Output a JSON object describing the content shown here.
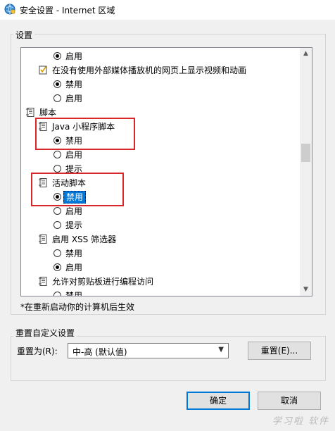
{
  "window": {
    "title": "安全设置 - Internet 区域",
    "icon": "globe-shield-icon"
  },
  "settings_group": {
    "label": "设置",
    "rows": [
      {
        "kind": "radio",
        "label": "启用",
        "checked": true
      },
      {
        "kind": "setting",
        "label": "在没有使用外部媒体播放机的网页上显示视频和动画",
        "icon": "checkbox-setting-icon"
      },
      {
        "kind": "radio",
        "label": "禁用",
        "checked": true
      },
      {
        "kind": "radio",
        "label": "启用",
        "checked": false
      },
      {
        "kind": "category",
        "label": "脚本",
        "icon": "script-icon"
      },
      {
        "kind": "setting",
        "label": "Java 小程序脚本",
        "icon": "script-icon"
      },
      {
        "kind": "radio",
        "label": "禁用",
        "checked": true
      },
      {
        "kind": "radio",
        "label": "启用",
        "checked": false
      },
      {
        "kind": "radio",
        "label": "提示",
        "checked": false
      },
      {
        "kind": "setting",
        "label": "活动脚本",
        "icon": "script-icon"
      },
      {
        "kind": "radio",
        "label": "禁用",
        "checked": true,
        "selected": true
      },
      {
        "kind": "radio",
        "label": "启用",
        "checked": false
      },
      {
        "kind": "radio",
        "label": "提示",
        "checked": false
      },
      {
        "kind": "setting",
        "label": "启用 XSS 筛选器",
        "icon": "script-icon"
      },
      {
        "kind": "radio",
        "label": "禁用",
        "checked": false
      },
      {
        "kind": "radio",
        "label": "启用",
        "checked": true
      },
      {
        "kind": "setting",
        "label": "允许对剪贴板进行编程访问",
        "icon": "script-icon"
      },
      {
        "kind": "radio",
        "label": "禁用",
        "checked": false
      }
    ],
    "note": "*在重新启动你的计算机后生效"
  },
  "reset_group": {
    "label": "重置自定义设置",
    "reset_to_label": "重置为(R):",
    "reset_level": "中-高 (默认值)",
    "reset_button": "重置(E)..."
  },
  "footer": {
    "ok_button": "确定",
    "cancel_button": "取消"
  },
  "watermark": "学习啦 软件"
}
